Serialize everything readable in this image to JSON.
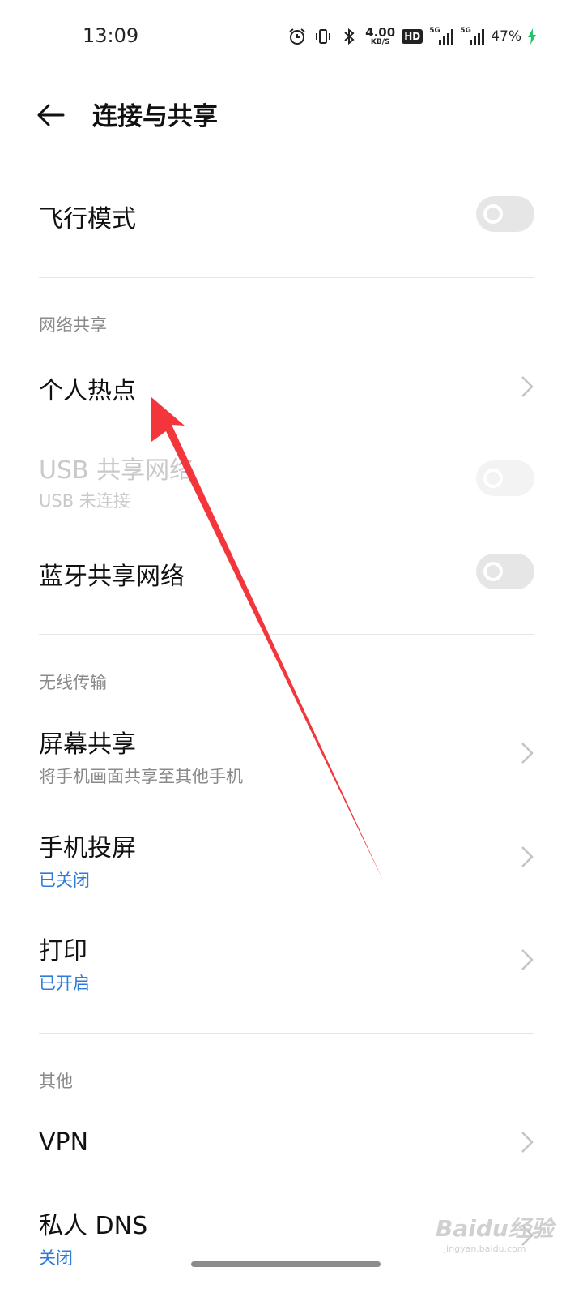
{
  "status_bar": {
    "time": "13:09",
    "net_speed": "4.00",
    "net_speed_unit": "KB/S",
    "hd_badge": "HD",
    "signal_1": "5G",
    "signal_2": "5G",
    "battery": "47%",
    "icons": [
      "alarm-icon",
      "vibrate-icon",
      "bluetooth-icon",
      "charging-icon"
    ]
  },
  "header": {
    "title": "连接与共享",
    "back_icon": "back-arrow-icon"
  },
  "items": {
    "airplane": {
      "title": "飞行模式",
      "on": false
    },
    "net_share_section": "网络共享",
    "hotspot": {
      "title": "个人热点"
    },
    "usb": {
      "title": "USB 共享网络",
      "subtitle": "USB 未连接",
      "on": false,
      "enabled": false
    },
    "bt_share": {
      "title": "蓝牙共享网络",
      "on": false
    },
    "wireless_section": "无线传输",
    "screen_share": {
      "title": "屏幕共享",
      "subtitle": "将手机画面共享至其他手机"
    },
    "cast": {
      "title": "手机投屏",
      "subtitle": "已关闭"
    },
    "print": {
      "title": "打印",
      "subtitle": "已开启"
    },
    "other_section": "其他",
    "vpn": {
      "title": "VPN"
    },
    "private_dns": {
      "title": "私人 DNS",
      "subtitle": "关闭"
    }
  },
  "watermark": {
    "text": "Baidu经验",
    "url": "jingyan.baidu.com"
  },
  "colors": {
    "accent_blue": "#2f7bd8",
    "annotation_red": "#f2363c",
    "toggle_off": "#e6e6e6"
  }
}
